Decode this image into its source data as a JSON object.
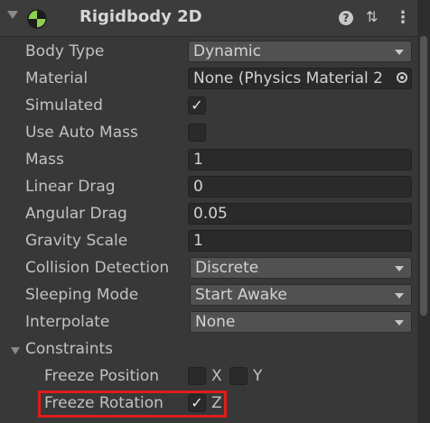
{
  "component": {
    "title": "Rigidbody 2D",
    "help_icon": "help-icon",
    "preset_icon": "preset-icon",
    "menu_icon": "kebab-menu-icon"
  },
  "fields": {
    "body_type": {
      "label": "Body Type",
      "value": "Dynamic"
    },
    "material": {
      "label": "Material",
      "value": "None (Physics Material 2"
    },
    "simulated": {
      "label": "Simulated",
      "checked": true
    },
    "use_auto_mass": {
      "label": "Use Auto Mass",
      "checked": false
    },
    "mass": {
      "label": "Mass",
      "value": "1"
    },
    "linear_drag": {
      "label": "Linear Drag",
      "value": "0"
    },
    "angular_drag": {
      "label": "Angular Drag",
      "value": "0.05"
    },
    "gravity_scale": {
      "label": "Gravity Scale",
      "value": "1"
    },
    "collision_detection": {
      "label": "Collision Detection",
      "value": "Discrete"
    },
    "sleeping_mode": {
      "label": "Sleeping Mode",
      "value": "Start Awake"
    },
    "interpolate": {
      "label": "Interpolate",
      "value": "None"
    }
  },
  "constraints": {
    "label": "Constraints",
    "freeze_position": {
      "label": "Freeze Position",
      "x_label": "X",
      "y_label": "Y",
      "x_checked": false,
      "y_checked": false
    },
    "freeze_rotation": {
      "label": "Freeze Rotation",
      "z_label": "Z",
      "z_checked": true
    }
  },
  "check_mark": "✓",
  "colors": {
    "highlight": "#e01c1c",
    "background": "#383838"
  }
}
